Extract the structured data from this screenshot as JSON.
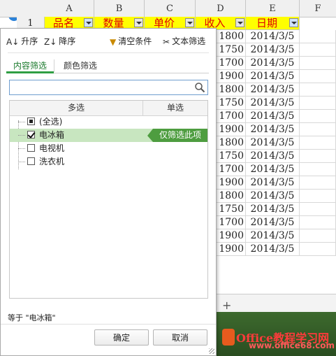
{
  "sheet": {
    "columns": [
      "A",
      "B",
      "C",
      "D",
      "E",
      "F"
    ],
    "header_row_number": "1",
    "headers": [
      "品名",
      "数量",
      "单价",
      "收入",
      "日期"
    ],
    "income": [
      "1800",
      "1750",
      "1700",
      "1900",
      "1800",
      "1750",
      "1700",
      "1900",
      "1800",
      "1750",
      "1700",
      "1900",
      "1800",
      "1750",
      "1700",
      "1900",
      "1900"
    ],
    "dates": [
      "2014/3/5",
      "2014/3/5",
      "2014/3/5",
      "2014/3/5",
      "2014/3/5",
      "2014/3/5",
      "2014/3/5",
      "2014/3/5",
      "2014/3/5",
      "2014/3/5",
      "2014/3/5",
      "2014/3/5",
      "2014/3/5",
      "2014/3/5",
      "2014/3/5",
      "2014/3/5",
      "2014/3/5"
    ],
    "add_sheet": "+",
    "header_bg": "#ffff00",
    "header_color": "#e00000"
  },
  "watermark": {
    "text": "Office教程学习网",
    "url": "www.office68.com"
  },
  "filter_panel": {
    "sort_asc": "升序",
    "sort_desc": "降序",
    "clear": "清空条件",
    "text_filter": "文本筛选",
    "tabs": [
      "内容筛选",
      "颜色筛选"
    ],
    "search_placeholder": "",
    "list_headers": [
      "多选",
      "单选"
    ],
    "items": [
      {
        "label": "(全选)",
        "state": "partial"
      },
      {
        "label": "电冰箱",
        "state": "checked"
      },
      {
        "label": "电视机",
        "state": "unchecked"
      },
      {
        "label": "洗衣机",
        "state": "unchecked"
      }
    ],
    "only_this": "仅筛选此项",
    "status": "等于 \"电冰箱\"",
    "ok": "确定",
    "cancel": "取消",
    "accent": "#4e9d40",
    "selected_bg": "#c8e6c0"
  }
}
